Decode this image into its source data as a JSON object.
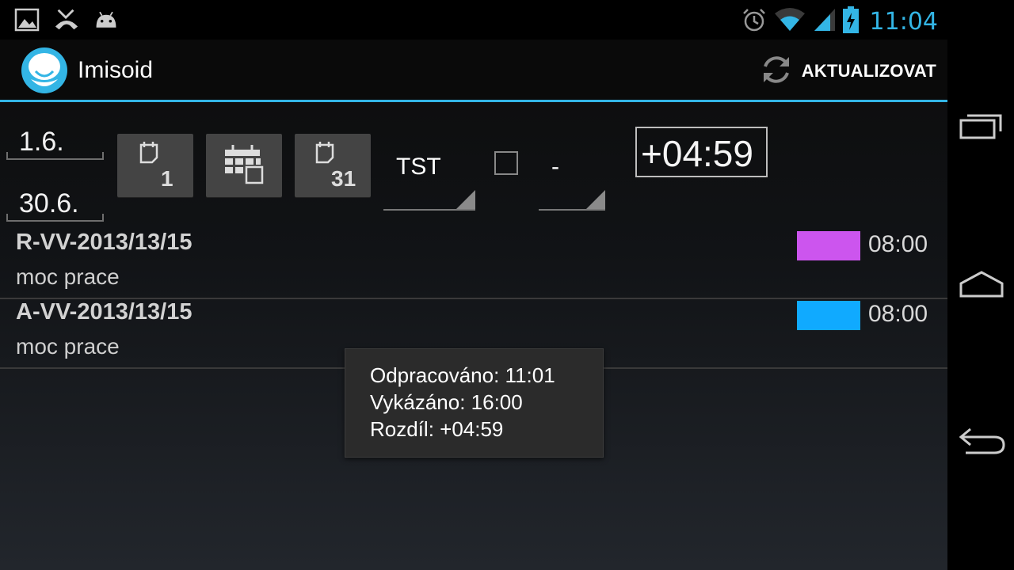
{
  "status_bar": {
    "time": "11:04",
    "notification_icons": [
      "image-icon",
      "missed-call-icon",
      "android-debug-icon"
    ],
    "system_icons": [
      "alarm-icon",
      "wifi-icon",
      "signal-icon",
      "battery-charging-icon"
    ]
  },
  "action_bar": {
    "title": "Imisoid",
    "refresh_label": "AKTUALIZOVAT"
  },
  "controls": {
    "date_from": "1.6.",
    "date_to": "30.6.",
    "buttons": [
      "calendar-day-icon",
      "calendar-month-grid-icon",
      "calendar-month-end-icon"
    ],
    "day_label": "1",
    "month_end_label": "31",
    "spinner_project": "TST",
    "spinner_second": "-",
    "difference": "+04:59"
  },
  "entries": [
    {
      "code": "R-VV-2013/13/15",
      "description": "moc prace",
      "hours": "08:00",
      "color": "#cc55ee"
    },
    {
      "code": "A-VV-2013/13/15",
      "description": "moc prace",
      "hours": "08:00",
      "color": "#10aaff"
    }
  ],
  "toast": {
    "line1": "Odpracováno: 11:01",
    "line2": "Vykázáno: 16:00",
    "line3": "Rozdíl: +04:59"
  },
  "colors": {
    "accent": "#33b5e5"
  },
  "nav_bar": [
    "recent-apps-icon",
    "home-icon",
    "back-icon"
  ]
}
